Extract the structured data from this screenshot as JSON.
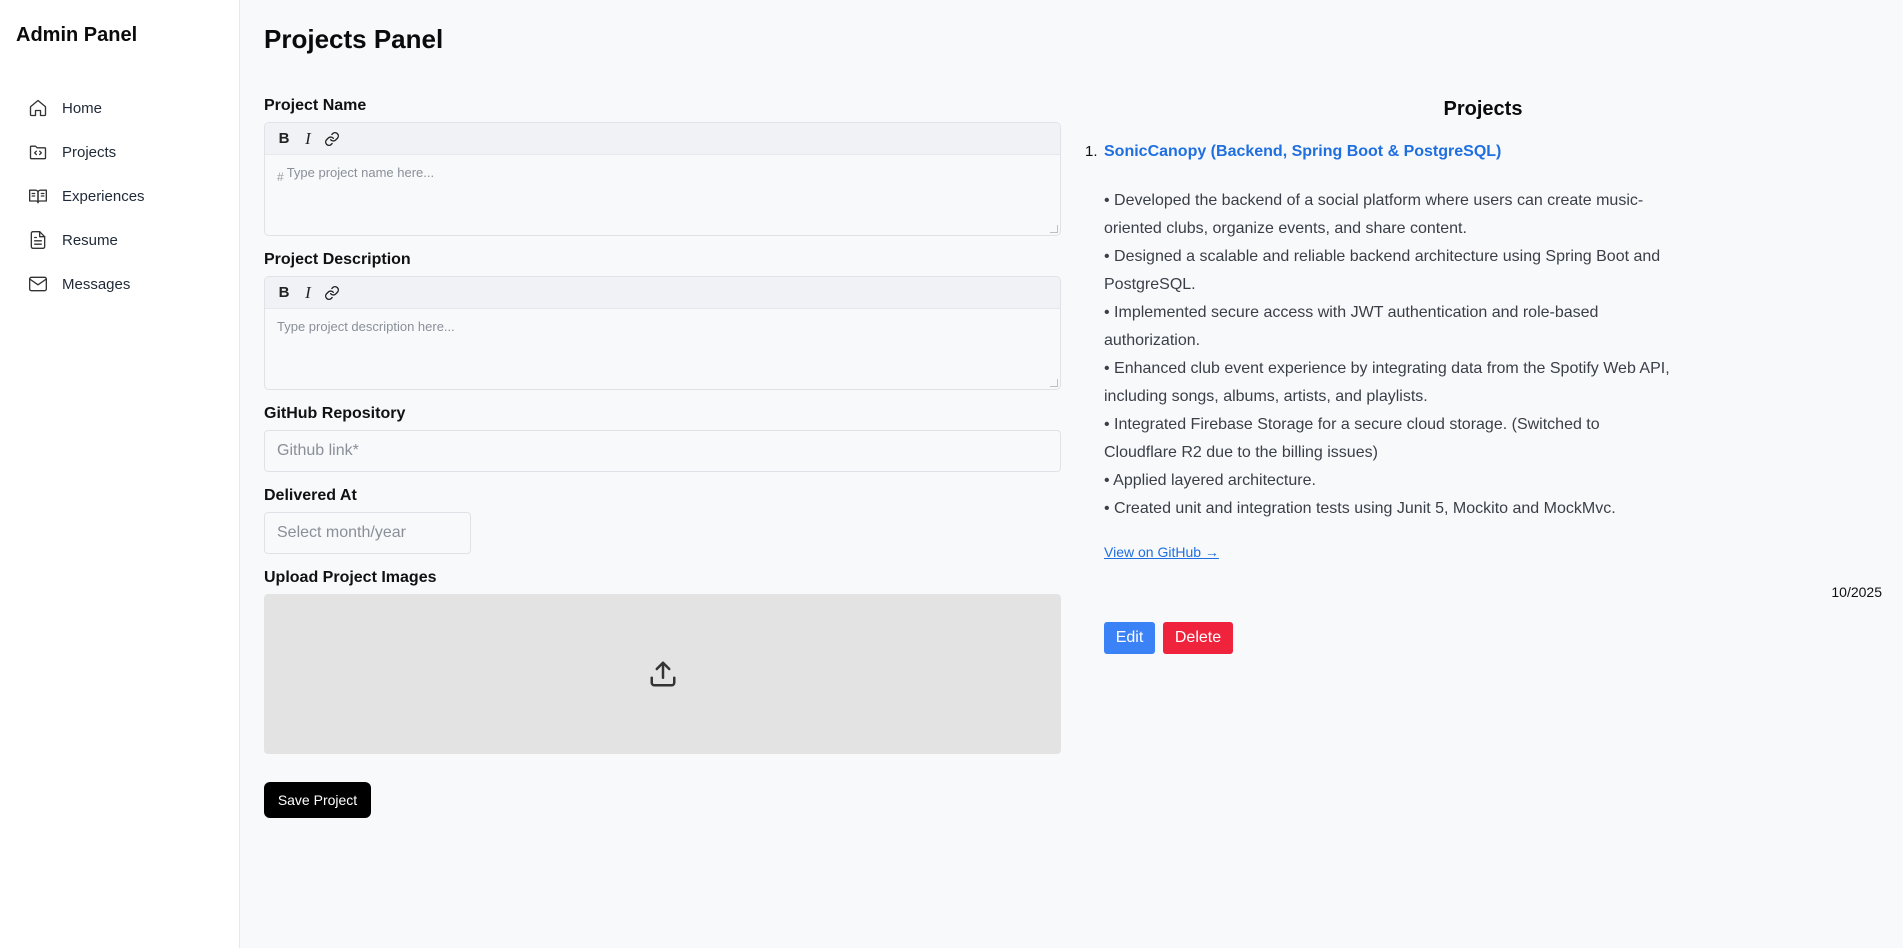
{
  "sidebar": {
    "title": "Admin Panel",
    "items": [
      {
        "label": "Home",
        "icon": "home-icon"
      },
      {
        "label": "Projects",
        "icon": "folder-code-icon"
      },
      {
        "label": "Experiences",
        "icon": "book-open-icon"
      },
      {
        "label": "Resume",
        "icon": "file-text-icon"
      },
      {
        "label": "Messages",
        "icon": "mail-icon"
      }
    ]
  },
  "main": {
    "title": "Projects Panel",
    "form": {
      "name_label": "Project Name",
      "name_placeholder": "Type project name here...",
      "name_prefix": "#",
      "description_label": "Project Description",
      "description_placeholder": "Type project description here...",
      "toolbar": {
        "bold": "B",
        "italic": "I"
      },
      "github_label": "GitHub Repository",
      "github_placeholder": "Github link*",
      "delivered_label": "Delivered At",
      "delivered_placeholder": "Select month/year",
      "upload_label": "Upload Project Images",
      "save_label": "Save Project"
    }
  },
  "projects": {
    "title": "Projects",
    "items": [
      {
        "index": "1.",
        "name": "SonicCanopy (Backend, Spring Boot & PostgreSQL)",
        "bullets": [
          "• Developed the backend of a social platform where users can create music-oriented clubs, organize events, and share content.",
          "• Designed a scalable and reliable backend architecture using Spring Boot and PostgreSQL.",
          "• Implemented secure access with JWT authentication and role-based authorization.",
          "• Enhanced club event experience by integrating data from the Spotify Web API, including songs, albums, artists, and playlists.",
          "• Integrated Firebase Storage for a secure cloud storage. (Switched to Cloudflare R2 due to the billing issues)",
          "• Applied layered architecture.",
          "• Created unit and integration tests using Junit 5, Mockito and MockMvc."
        ],
        "link_label": "View on GitHub →",
        "date": "10/2025",
        "edit_label": "Edit",
        "delete_label": "Delete"
      }
    ]
  },
  "colors": {
    "link": "#1f6fe0",
    "edit": "#3b82f6",
    "delete": "#ef233c",
    "save": "#000000"
  }
}
